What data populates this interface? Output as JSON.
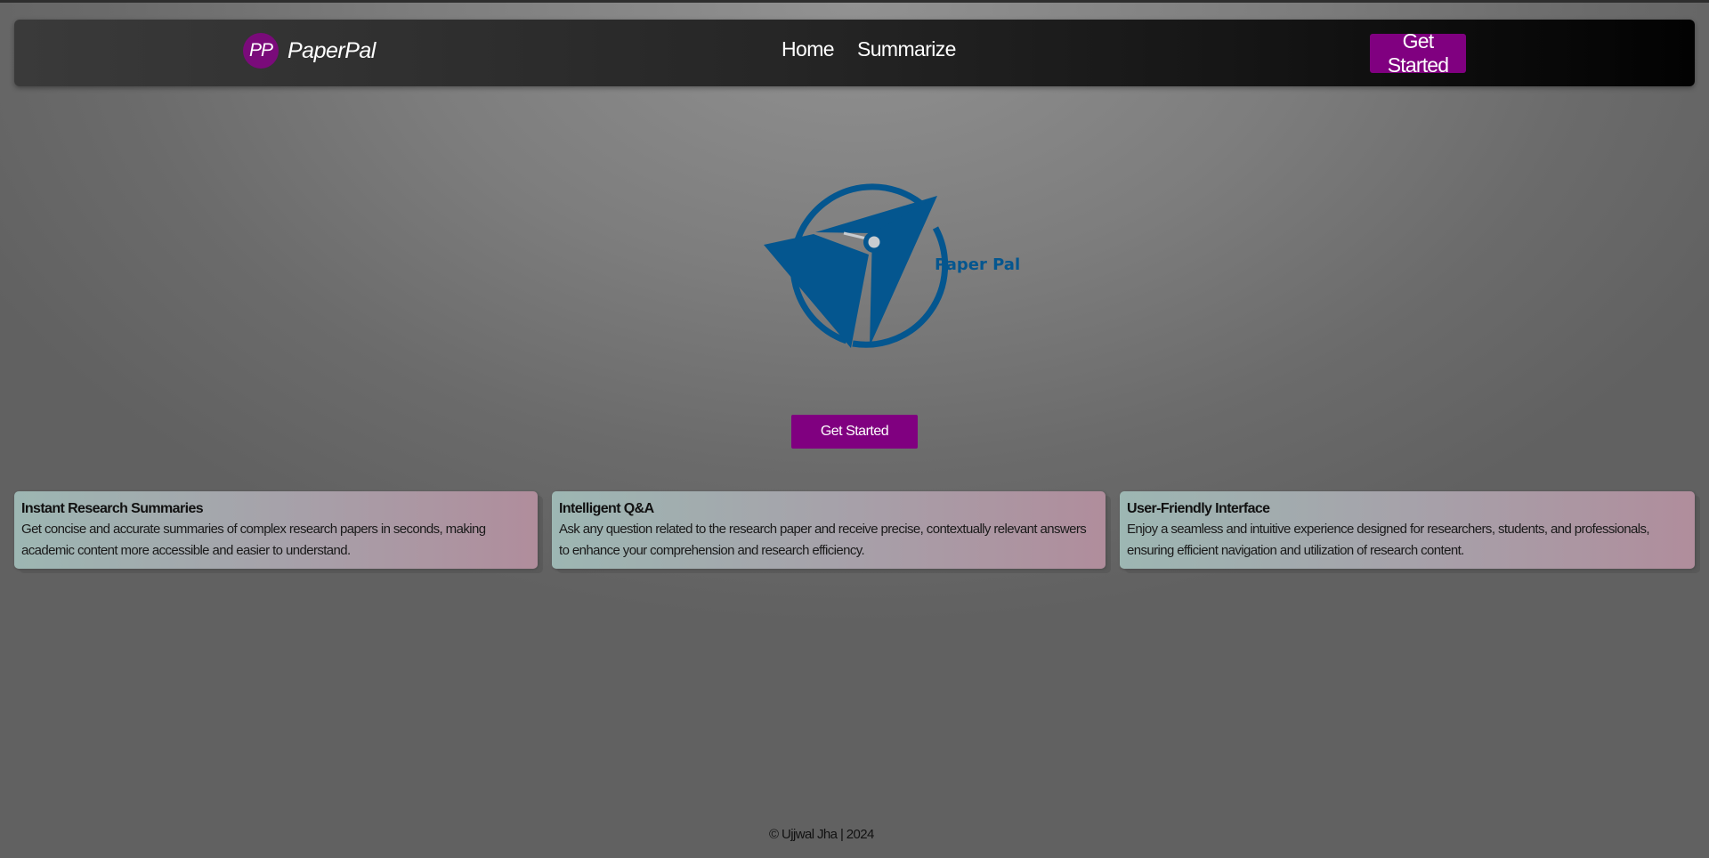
{
  "navbar": {
    "brand_badge": "PP",
    "brand_name": "PaperPal",
    "links": [
      {
        "label": "Home"
      },
      {
        "label": "Summarize"
      }
    ],
    "cta_label": "Get Started"
  },
  "hero": {
    "logo_text": "Paper Pal",
    "cta_label": "Get Started"
  },
  "features": [
    {
      "title": "Instant Research Summaries",
      "text": "Get concise and accurate summaries of complex research papers in seconds, making academic content more accessible and easier to understand."
    },
    {
      "title": "Intelligent Q&A",
      "text": "Ask any question related to the research paper and receive precise, contextually relevant answers to enhance your comprehension and research efficiency."
    },
    {
      "title": "User-Friendly Interface",
      "text": "Enjoy a seamless and intuitive experience designed for researchers, students, and professionals, ensuring efficient navigation and utilization of research content."
    }
  ],
  "footer": {
    "text": "© Ujjwal Jha | 2024"
  },
  "colors": {
    "accent": "#800080",
    "logo_blue": "#04568f"
  }
}
